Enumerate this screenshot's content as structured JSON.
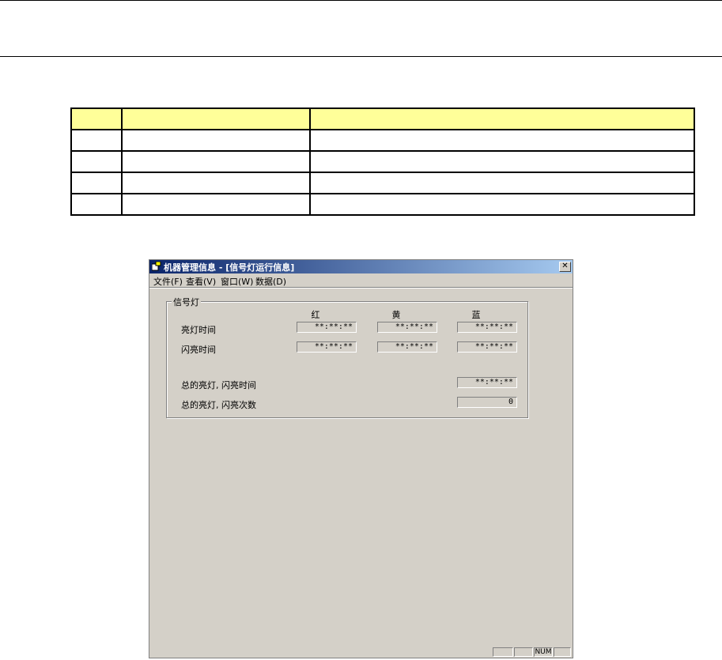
{
  "doc_table": {
    "rows": [
      [
        "",
        "",
        ""
      ],
      [
        "",
        "",
        ""
      ],
      [
        "",
        "",
        ""
      ],
      [
        "",
        "",
        ""
      ],
      [
        "",
        "",
        ""
      ]
    ]
  },
  "window": {
    "title": "机器管理信息 - [信号灯运行信息]",
    "close_glyph": "✕",
    "menu": [
      "文件(F)",
      "查看(V)",
      "窗口(W)",
      "数据(D)"
    ],
    "group_label": "信号灯",
    "columns": [
      "红",
      "黄",
      "蓝"
    ],
    "rows": [
      {
        "label": "亮灯时间",
        "values": [
          "**:**:**",
          "**:**:**",
          "**:**:**"
        ]
      },
      {
        "label": "闪亮时间",
        "values": [
          "**:**:**",
          "**:**:**",
          "**:**:**"
        ]
      }
    ],
    "total_time_label": "总的亮灯, 闪亮时间",
    "total_time_value": "**:**:**",
    "total_count_label": "总的亮灯, 闪亮次数",
    "total_count_value": "0",
    "status": {
      "num": "NUM"
    }
  }
}
